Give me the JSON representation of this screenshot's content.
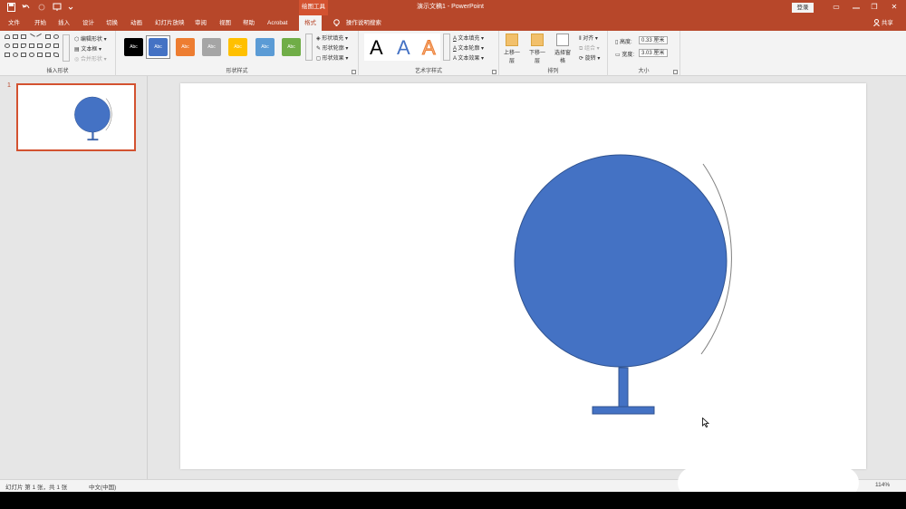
{
  "window": {
    "context_tab_group": "绘图工具",
    "doc_title": "演示文稿1 - PowerPoint",
    "login": "登录",
    "minimize": "▭",
    "restore": "❐",
    "close": "✕"
  },
  "tabs": [
    {
      "label": "文件"
    },
    {
      "label": "开始"
    },
    {
      "label": "插入"
    },
    {
      "label": "设计"
    },
    {
      "label": "切换"
    },
    {
      "label": "动画"
    },
    {
      "label": "幻灯片放映"
    },
    {
      "label": "审阅"
    },
    {
      "label": "视图"
    },
    {
      "label": "帮助"
    },
    {
      "label": "Acrobat"
    },
    {
      "label": "格式"
    }
  ],
  "tell_me": "操作说明搜索",
  "share": "共享",
  "ribbon": {
    "insert_shapes": {
      "label": "插入形状",
      "edit_shape": "编辑形状",
      "text_box": "文本框",
      "merge_shapes": "合并形状"
    },
    "shape_styles": {
      "label": "形状样式",
      "swatches": [
        {
          "text": "Abc",
          "color": "#000000"
        },
        {
          "text": "Abc",
          "color": "#4472c4"
        },
        {
          "text": "Abc",
          "color": "#ed7d31"
        },
        {
          "text": "Abc",
          "color": "#a5a5a5"
        },
        {
          "text": "Abc",
          "color": "#ffc000"
        },
        {
          "text": "Abc",
          "color": "#5b9bd5"
        },
        {
          "text": "Abc",
          "color": "#70ad47"
        }
      ],
      "fill": "形状填充",
      "outline": "形状轮廓",
      "effects": "形状效果"
    },
    "wordart": {
      "label": "艺术字样式",
      "letter": "A",
      "text_fill": "文本填充",
      "text_outline": "文本轮廓",
      "text_effects": "文本效果"
    },
    "arrange": {
      "label": "排列",
      "bring_forward": "上移一层",
      "send_backward": "下移一层",
      "selection_pane": "选择窗格",
      "align": "对齐",
      "group": "组合",
      "rotate": "旋转"
    },
    "size": {
      "label": "大小",
      "height_label": "高度:",
      "height_value": "0.33 厘米",
      "width_label": "宽度:",
      "width_value": "3.03 厘米"
    }
  },
  "thumbnails": [
    {
      "number": "1"
    }
  ],
  "slide": {
    "globe_color": "#4472c4",
    "globe_outline": "#2f528f"
  },
  "status": {
    "slide_info": "幻灯片 第 1 张，共 1 张",
    "language": "中文(中国)",
    "zoom": "114%"
  }
}
